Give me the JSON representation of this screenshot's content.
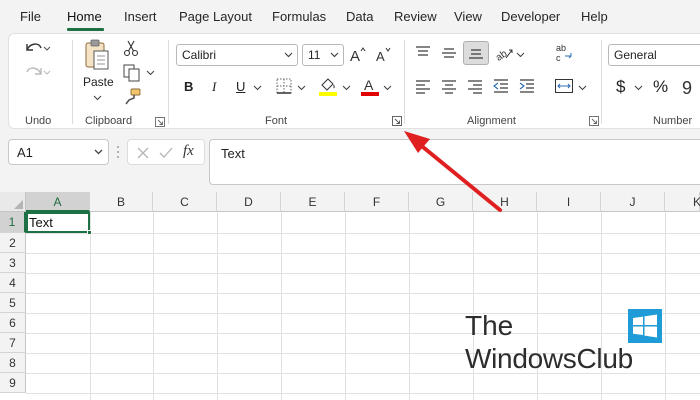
{
  "menu": {
    "tabs": [
      {
        "label": "File"
      },
      {
        "label": "Home",
        "active": true
      },
      {
        "label": "Insert"
      },
      {
        "label": "Page Layout"
      },
      {
        "label": "Formulas"
      },
      {
        "label": "Data"
      },
      {
        "label": "Review"
      },
      {
        "label": "View"
      },
      {
        "label": "Developer"
      },
      {
        "label": "Help"
      }
    ]
  },
  "ribbon": {
    "undo": {
      "label": "Undo"
    },
    "clipboard": {
      "label": "Clipboard",
      "paste_label": "Paste"
    },
    "font": {
      "label": "Font",
      "font_name": "Calibri",
      "font_size": "11",
      "bold": "B",
      "italic": "I",
      "underline": "U",
      "fill_color": "#ffff00",
      "font_color": "#e00000"
    },
    "alignment": {
      "label": "Alignment"
    },
    "number": {
      "label": "Number",
      "format": "General",
      "currency_symbol": "$",
      "percent_symbol": "%"
    }
  },
  "formula_bar": {
    "name_box": "A1",
    "fx_label": "fx",
    "content": "Text"
  },
  "sheet": {
    "columns": [
      "A",
      "B",
      "C",
      "D",
      "E",
      "F",
      "G",
      "H",
      "I",
      "J",
      "K"
    ],
    "rows": [
      "1",
      "2",
      "3",
      "4",
      "5",
      "6",
      "7",
      "8",
      "9"
    ],
    "selected_column": "A",
    "selected_row": "1",
    "cells": {
      "A1": "Text"
    }
  },
  "watermark": {
    "line1": "The",
    "line2": "WindowsClub"
  },
  "colors": {
    "accent": "#1e7145",
    "arrow": "#e02020"
  }
}
